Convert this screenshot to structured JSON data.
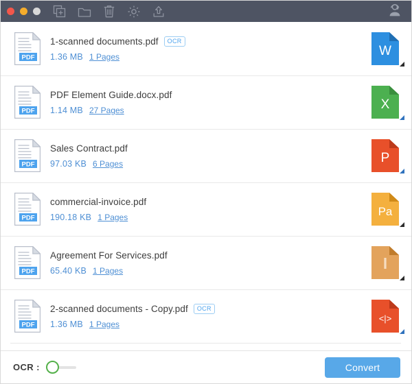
{
  "titlebar": {
    "background": "#4e5463",
    "traffic_lights": [
      {
        "name": "close",
        "color": "#f3574b"
      },
      {
        "name": "minimize",
        "color": "#f5ad2c"
      },
      {
        "name": "zoom",
        "color": "#d8d8d8"
      }
    ],
    "tools": [
      {
        "icon": "add-file-icon",
        "label": "Add File"
      },
      {
        "icon": "folder-icon",
        "label": "Add Folder"
      },
      {
        "icon": "trash-icon",
        "label": "Remove"
      },
      {
        "icon": "gear-icon",
        "label": "Settings"
      },
      {
        "icon": "upload-icon",
        "label": "Upload"
      }
    ],
    "support": {
      "icon": "support-agent-icon",
      "label": "Support"
    }
  },
  "files": [
    {
      "name": "1-scanned documents.pdf",
      "ocr_badge": "OCR",
      "has_ocr": true,
      "size": "1.36 MB",
      "pages": "1 Pages",
      "format": {
        "letter": "W",
        "name": "word-format-icon",
        "color": "#2d8fe0",
        "fold": "#1f6fb4",
        "caret": "dark"
      }
    },
    {
      "name": "PDF Element Guide.docx.pdf",
      "ocr_badge": "",
      "has_ocr": false,
      "size": "1.14 MB",
      "pages": "27 Pages",
      "format": {
        "letter": "X",
        "name": "excel-format-icon",
        "color": "#4cb050",
        "fold": "#3a8f3e",
        "caret": "blue"
      }
    },
    {
      "name": "Sales Contract.pdf",
      "ocr_badge": "",
      "has_ocr": false,
      "size": "97.03 KB",
      "pages": "6 Pages",
      "format": {
        "letter": "P",
        "name": "powerpoint-format-icon",
        "color": "#e8502a",
        "fold": "#bd3a1b",
        "caret": "blue"
      }
    },
    {
      "name": "commercial-invoice.pdf",
      "ocr_badge": "",
      "has_ocr": false,
      "size": "190.18 KB",
      "pages": "1 Pages",
      "format": {
        "letter": "Pa",
        "name": "pages-format-icon",
        "color": "#f4b03e",
        "fold": "#d08a18",
        "caret": "dark"
      }
    },
    {
      "name": "Agreement For Services.pdf",
      "ocr_badge": "",
      "has_ocr": false,
      "size": "65.40 KB",
      "pages": "1 Pages",
      "format": {
        "letter": "I",
        "name": "image-format-icon",
        "color": "#e3a35c",
        "fold": "#c07c2c",
        "caret": "dark"
      }
    },
    {
      "name": "2-scanned documents - Copy.pdf",
      "ocr_badge": "OCR",
      "has_ocr": true,
      "size": "1.36 MB",
      "pages": "1 Pages",
      "format": {
        "letter": "<|>",
        "name": "html-format-icon",
        "color": "#e8502a",
        "fold": "#bd3a1b",
        "caret": "blue"
      }
    }
  ],
  "file_icon": {
    "badge": "PDF",
    "name": "pdf-file-icon"
  },
  "bottombar": {
    "ocr_label": "OCR :",
    "ocr_enabled": false,
    "convert_label": "Convert",
    "convert_color": "#58a8e8",
    "toggle_ring_color": "#54b04a"
  }
}
